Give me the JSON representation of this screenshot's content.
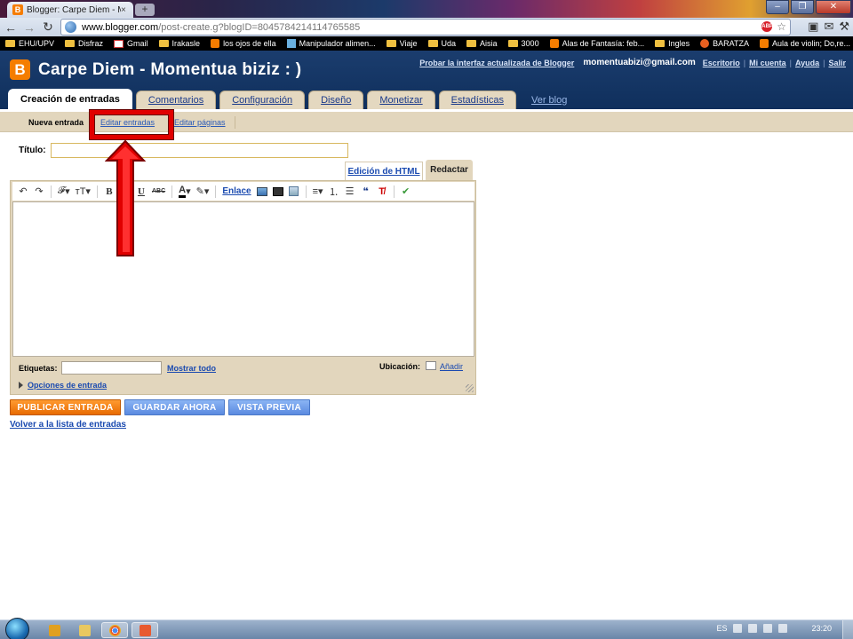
{
  "browser": {
    "tab_title": "Blogger: Carpe Diem - Mom",
    "tab_close": "×",
    "new_tab": "+",
    "url_host": "www.blogger.com",
    "url_path": "/post-create.g?blogID=8045784214114765585",
    "window_controls": {
      "minimize": "–",
      "maximize": "❐",
      "close": "✕"
    },
    "bookmarks": [
      {
        "label": "EHU/UPV",
        "icon": "folder-icon"
      },
      {
        "label": "Disfraz",
        "icon": "folder-icon"
      },
      {
        "label": "Gmail",
        "icon": "gmail-icon"
      },
      {
        "label": "Irakasle",
        "icon": "folder-icon"
      },
      {
        "label": "los ojos de ella",
        "icon": "blogger-icon"
      },
      {
        "label": "Manipulador alimen...",
        "icon": "page-icon"
      },
      {
        "label": "Viaje",
        "icon": "folder-icon"
      },
      {
        "label": "Uda",
        "icon": "folder-icon"
      },
      {
        "label": "Aisia",
        "icon": "folder-icon"
      },
      {
        "label": "3000",
        "icon": "folder-icon"
      },
      {
        "label": "Alas de Fantasía: feb...",
        "icon": "blogger-icon"
      },
      {
        "label": "Ingles",
        "icon": "folder-icon"
      },
      {
        "label": "BARATZA",
        "icon": "orange-icon"
      },
      {
        "label": "Aula de violin; Do,re...",
        "icon": "blogger-icon"
      }
    ]
  },
  "header": {
    "logo_letter": "B",
    "blog_title": "Carpe Diem - Momentua biziz : )",
    "try_new_interface": "Probar la interfaz actualizada de Blogger",
    "email": "momentuabizi@gmail.com",
    "dashboard": "Escritorio",
    "my_account": "Mi cuenta",
    "help": "Ayuda",
    "sign_out": "Salir",
    "separator": "|"
  },
  "main_tabs": [
    {
      "label": "Creación de entradas",
      "active": true
    },
    {
      "label": "Comentarios",
      "active": false
    },
    {
      "label": "Configuración",
      "active": false
    },
    {
      "label": "Diseño",
      "active": false
    },
    {
      "label": "Monetizar",
      "active": false
    },
    {
      "label": "Estadísticas",
      "active": false
    },
    {
      "label": "Ver blog",
      "active": false
    }
  ],
  "sub_tabs": {
    "new_post": "Nueva entrada",
    "edit_posts": "Editar entradas",
    "edit_pages": "Editar páginas"
  },
  "editor": {
    "title_label": "Título:",
    "title_value": "",
    "mode_html": "Edición de HTML",
    "mode_compose": "Redactar",
    "toolbar": {
      "undo": "↶",
      "redo": "↷",
      "font": "𝓕",
      "font_size": "ᴛT",
      "bold": "B",
      "italic": "I",
      "underline": "U",
      "strike": "ABC",
      "text_color": "A",
      "highlight": "✎",
      "link": "Enlace",
      "align": "≡",
      "numbered_list": "⒈",
      "bullet_list": "☰",
      "quote": "❝",
      "clear_format": "T̸",
      "spellcheck": "✔",
      "dropdown": "▾"
    },
    "body": "",
    "labels_label": "Etiquetas:",
    "labels_value": "",
    "show_all": "Mostrar todo",
    "location_label": "Ubicación:",
    "location_add": "Añadir",
    "post_options": "Opciones de entrada"
  },
  "actions": {
    "publish": "PUBLICAR ENTRADA",
    "save_now": "GUARDAR AHORA",
    "preview": "VISTA PREVIA",
    "back_to_list": "Volver a la lista de entradas"
  },
  "taskbar": {
    "language": "ES",
    "time": "23:20"
  },
  "colors": {
    "blogger_orange": "#f57d00",
    "header_blue": "#1b3d6e",
    "tab_beige": "#e2d6bd",
    "link_blue": "#1a4ab0",
    "annotation_red": "#e00000"
  }
}
